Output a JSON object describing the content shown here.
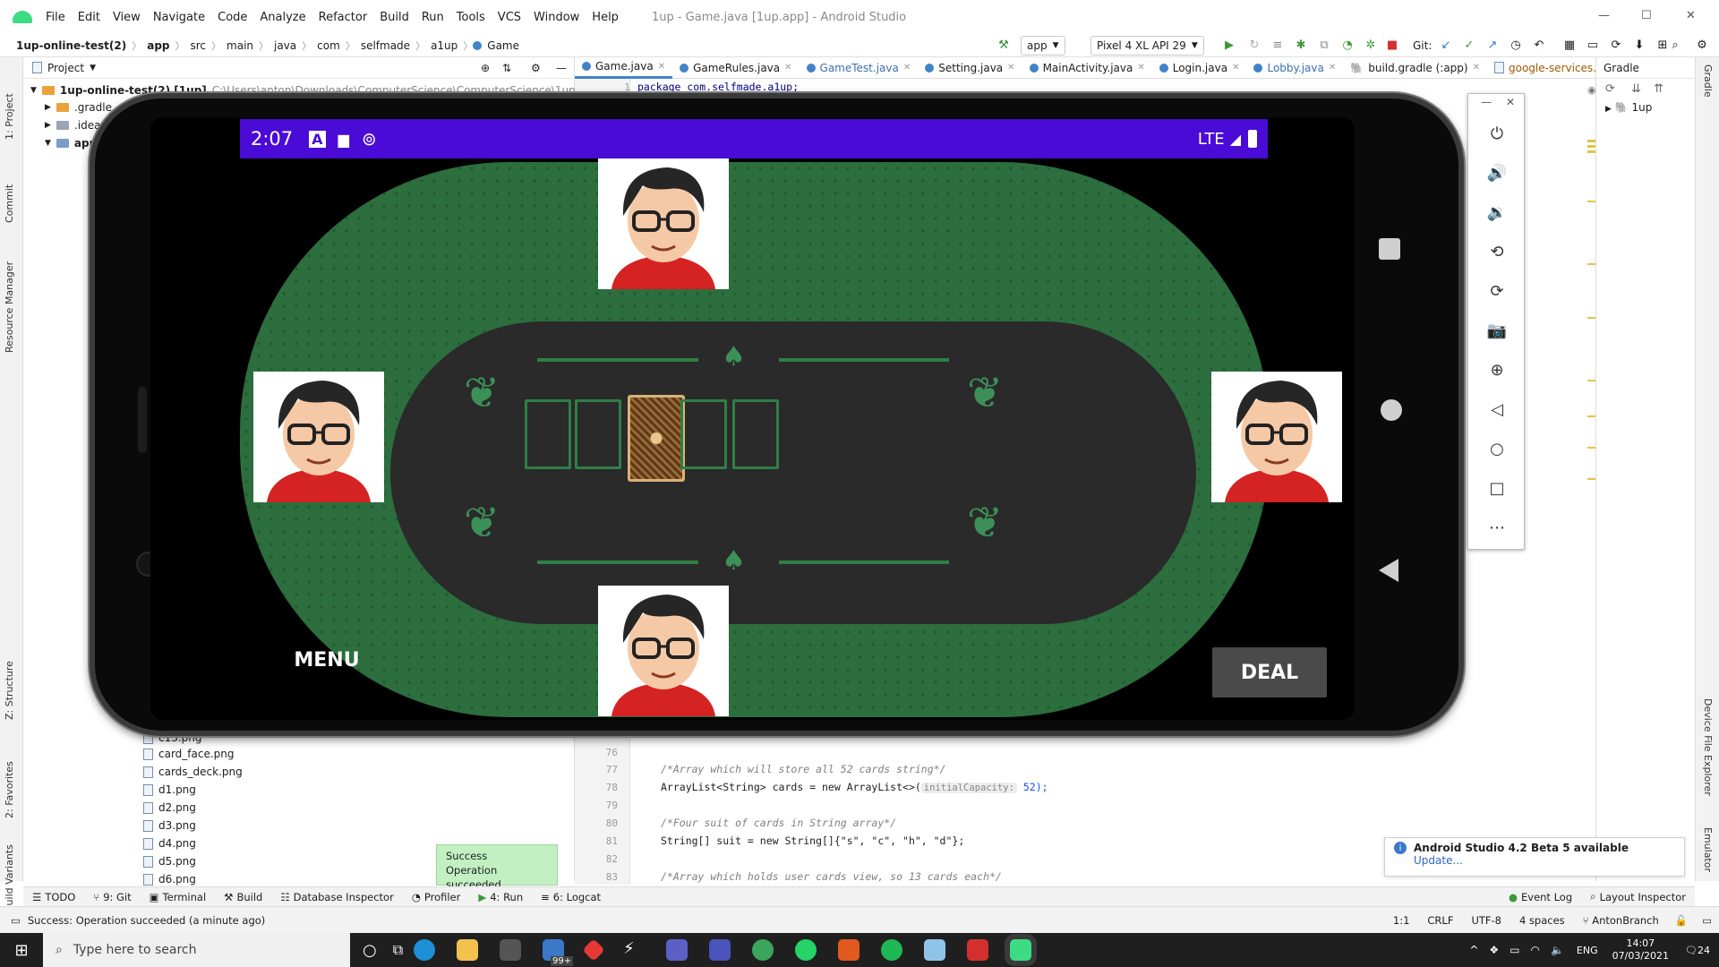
{
  "window": {
    "title": "1up - Game.java [1up.app] - Android Studio",
    "controls": [
      "—",
      "☐",
      "✕"
    ]
  },
  "menu": [
    "File",
    "Edit",
    "View",
    "Navigate",
    "Code",
    "Analyze",
    "Refactor",
    "Build",
    "Run",
    "Tools",
    "VCS",
    "Window",
    "Help"
  ],
  "breadcrumb": [
    "1up-online-test(2)",
    "app",
    "src",
    "main",
    "java",
    "com",
    "selfmade",
    "a1up",
    "Game"
  ],
  "toolbar": {
    "config": "app",
    "device": "Pixel 4 XL API 29",
    "git_label": "Git:"
  },
  "project": {
    "header": "Project",
    "root": "1up-online-test(2) [1up]",
    "root_path": "C:\\Users\\anton\\Downloads\\ComputerScience\\ComputerScience\\1up-online-t",
    "items": [
      ".gradle",
      ".idea",
      "app"
    ],
    "files": [
      "c13.png",
      "card_face.png",
      "cards_deck.png",
      "d1.png",
      "d2.png",
      "d3.png",
      "d4.png",
      "d5.png",
      "d6.png"
    ]
  },
  "tabs": [
    {
      "label": "Game.java",
      "active": true
    },
    {
      "label": "GameRules.java"
    },
    {
      "label": "GameTest.java"
    },
    {
      "label": "Setting.java"
    },
    {
      "label": "MainActivity.java"
    },
    {
      "label": "Login.java"
    },
    {
      "label": "Lobby.java"
    },
    {
      "label": "build.gradle (:app)"
    },
    {
      "label": "google-services.json"
    }
  ],
  "code": {
    "top_line": "package com.selfmade.a1up;",
    "lines": [
      {
        "n": "76",
        "text": ""
      },
      {
        "n": "77",
        "text": "/*Array which will store all 52 cards string*/",
        "cls": "cm"
      },
      {
        "n": "78",
        "text": "ArrayList<String> cards = new ArrayList<>(",
        "hint": "initialCapacity:",
        "tail": " 52);"
      },
      {
        "n": "79",
        "text": ""
      },
      {
        "n": "80",
        "text": "/*Four suit of cards in String array*/",
        "cls": "cm"
      },
      {
        "n": "81",
        "text": "String[] suit = new String[]{\"s\", \"c\", \"h\", \"d\"};"
      },
      {
        "n": "82",
        "text": ""
      },
      {
        "n": "83",
        "text": "/*Array which holds user cards view, so 13 cards each*/",
        "cls": "cm"
      }
    ]
  },
  "gradle": {
    "title": "Gradle",
    "item": "1up"
  },
  "emulator": {
    "time": "2:07",
    "network": "LTE",
    "menu_button": "MENU",
    "deal_button": "DEAL"
  },
  "bottom_tools": [
    "TODO",
    "9: Git",
    "Terminal",
    "Build",
    "Database Inspector",
    "Profiler",
    "4: Run",
    "6: Logcat"
  ],
  "bottom_right": [
    "Event Log",
    "Layout Inspector"
  ],
  "status": {
    "message": "Success: Operation succeeded (a minute ago)",
    "position": "1:1",
    "eol": "CRLF",
    "encoding": "UTF-8",
    "indent": "4 spaces",
    "branch": "AntonBranch"
  },
  "popup": {
    "title": "Success",
    "body": "Operation succeeded"
  },
  "notification": {
    "title": "Android Studio 4.2 Beta 5 available",
    "link": "Update..."
  },
  "left_strip": [
    "1: Project",
    "Commit",
    "Resource Manager",
    "Z: Structure",
    "2: Favorites",
    "Build Variants"
  ],
  "right_strip": [
    "Gradle",
    "Device File Explorer",
    "Emulator"
  ],
  "taskbar": {
    "search_placeholder": "Type here to search",
    "lang": "ENG",
    "time": "14:07",
    "date": "07/03/2021",
    "badge1": "99+",
    "badge2": "24"
  }
}
